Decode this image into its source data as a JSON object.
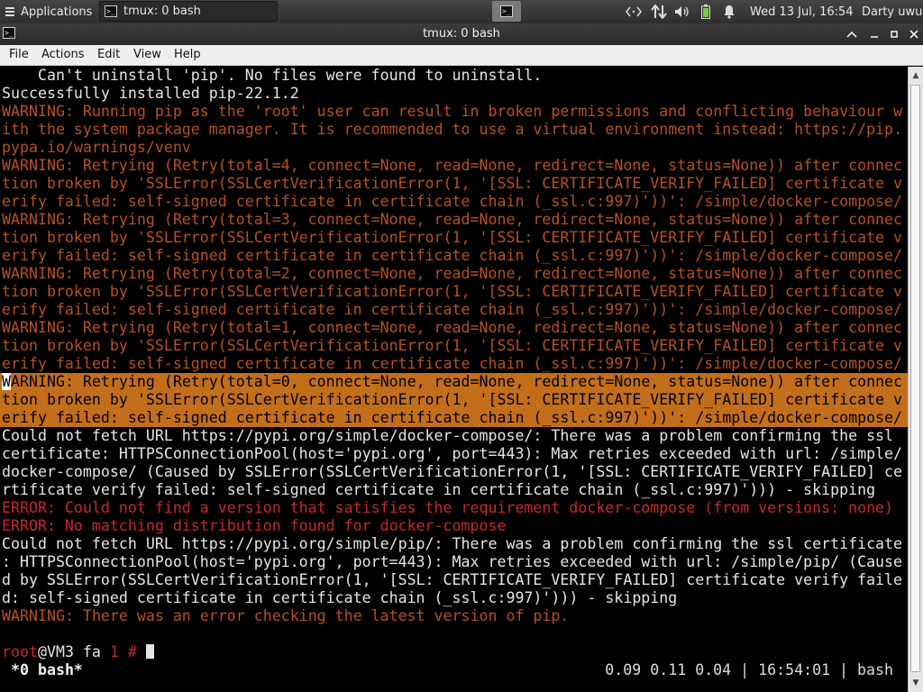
{
  "taskbar": {
    "apps_label": "Applications",
    "task_label": "tmux: 0 bash",
    "clock": "Wed 13 Jul, 16:54",
    "user": "Darty uwu",
    "icons": {
      "apps": "applications-menu-icon",
      "network": "network-icon",
      "transfer": "network-transfer-icon",
      "volume": "volume-icon",
      "battery": "battery-icon",
      "notifications": "bell-icon"
    }
  },
  "window": {
    "title": "tmux: 0 bash",
    "buttons": {
      "shade": "▲",
      "minimize": "_",
      "maximize": "▫",
      "close": "✕"
    }
  },
  "menubar": {
    "file": "File",
    "actions": "Actions",
    "edit": "Edit",
    "view": "View",
    "help": "Help"
  },
  "terminal": {
    "lines": [
      "    Can't uninstall 'pip'. No files were found to uninstall.",
      "Successfully installed pip-22.1.2",
      "WARNING: Running pip as the 'root' user can result in broken permissions and conflicting behaviour w",
      "ith the system package manager. It is recommended to use a virtual environment instead: https://pip.",
      "pypa.io/warnings/venv",
      "WARNING: Retrying (Retry(total=4, connect=None, read=None, redirect=None, status=None)) after connec",
      "tion broken by 'SSLError(SSLCertVerificationError(1, '[SSL: CERTIFICATE_VERIFY_FAILED] certificate v",
      "erify failed: self-signed certificate in certificate chain (_ssl.c:997)'))': /simple/docker-compose/",
      "WARNING: Retrying (Retry(total=3, connect=None, read=None, redirect=None, status=None)) after connec",
      "tion broken by 'SSLError(SSLCertVerificationError(1, '[SSL: CERTIFICATE_VERIFY_FAILED] certificate v",
      "erify failed: self-signed certificate in certificate chain (_ssl.c:997)'))': /simple/docker-compose/",
      "WARNING: Retrying (Retry(total=2, connect=None, read=None, redirect=None, status=None)) after connec",
      "tion broken by 'SSLError(SSLCertVerificationError(1, '[SSL: CERTIFICATE_VERIFY_FAILED] certificate v",
      "erify failed: self-signed certificate in certificate chain (_ssl.c:997)'))': /simple/docker-compose/",
      "WARNING: Retrying (Retry(total=1, connect=None, read=None, redirect=None, status=None)) after connec",
      "tion broken by 'SSLError(SSLCertVerificationError(1, '[SSL: CERTIFICATE_VERIFY_FAILED] certificate v",
      "erify failed: self-signed certificate in certificate chain (_ssl.c:997)'))': /simple/docker-compose/",
      "ARNING: Retrying (Retry(total=0, connect=None, read=None, redirect=None, status=None)) after connec",
      "tion broken by 'SSLError(SSLCertVerificationError(1, '[SSL: CERTIFICATE_VERIFY_FAILED] certificate v",
      "erify failed: self-signed certificate in certificate chain (_ssl.c:997)'))': /simple/docker-compose/",
      "Could not fetch URL https://pypi.org/simple/docker-compose/: There was a problem confirming the ssl",
      "certificate: HTTPSConnectionPool(host='pypi.org', port=443): Max retries exceeded with url: /simple/",
      "docker-compose/ (Caused by SSLError(SSLCertVerificationError(1, '[SSL: CERTIFICATE_VERIFY_FAILED] ce",
      "rtificate verify failed: self-signed certificate in certificate chain (_ssl.c:997)'))) - skipping",
      "ERROR: Could not find a version that satisfies the requirement docker-compose (from versions: none)",
      "ERROR: No matching distribution found for docker-compose",
      "Could not fetch URL https://pypi.org/simple/pip/: There was a problem confirming the ssl certificate",
      ": HTTPSConnectionPool(host='pypi.org', port=443): Max retries exceeded with url: /simple/pip/ (Cause",
      "d by SSLError(SSLCertVerificationError(1, '[SSL: CERTIFICATE_VERIFY_FAILED] certificate verify faile",
      "d: self-signed certificate in certificate chain (_ssl.c:997)'))) - skipping",
      "WARNING: There was an error checking the latest version of pip."
    ],
    "highlight_first_char": "W",
    "prompt": {
      "user": "root",
      "host": "@VM3 fa ",
      "num": "1",
      "hash": " # "
    },
    "status_left": "*0 bash*",
    "status_right": "0.09 0.11 0.04 | 16:54:01 | bash"
  }
}
